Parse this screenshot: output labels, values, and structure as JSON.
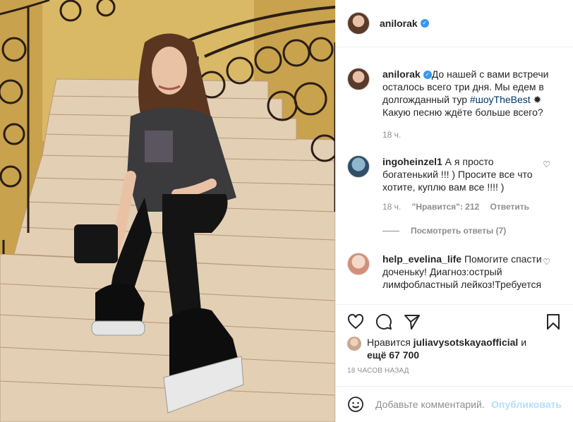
{
  "post": {
    "username": "anilorak",
    "caption": "До нашей с вами встречи осталось всего три дня. Мы едем в долгожданный тур ",
    "hashtag": "#шоуTheBest",
    "caption_tail": " ✹ Какую песню ждёте больше всего?",
    "time": "18 ч."
  },
  "comments": [
    {
      "username": "ingoheinzel1",
      "text": " А я просто богатенький !!! ) Просите все что хотите, куплю вам все !!!! )",
      "time": "18 ч.",
      "likes_label": "\"Нравится\": 212",
      "reply_label": "Ответить",
      "view_replies": "Посмотреть ответы (7)"
    },
    {
      "username": "help_evelina_life",
      "text": " Помогите спасти доченьку! Диагноз:острый лимфобластный лейкоз!Требуется"
    }
  ],
  "likes": {
    "prefix": "Нравится ",
    "user": "juliavysotskayaofficial",
    "mid": " и",
    "others": "ещё 67 700"
  },
  "timeago": "18 ЧАСОВ НАЗАД",
  "add_comment": {
    "placeholder": "Добавьте комментарий...",
    "post_label": "Опубликовать"
  },
  "icons": {
    "verified": "verified-badge-icon",
    "heart": "heart-icon",
    "comment": "comment-icon",
    "share": "share-icon",
    "save": "bookmark-icon",
    "emoji": "emoji-icon"
  },
  "colors": {
    "verified": "#3897f0",
    "hashtag": "#00376b",
    "muted": "#8e8e8e",
    "post_btn": "#b2dffc"
  }
}
